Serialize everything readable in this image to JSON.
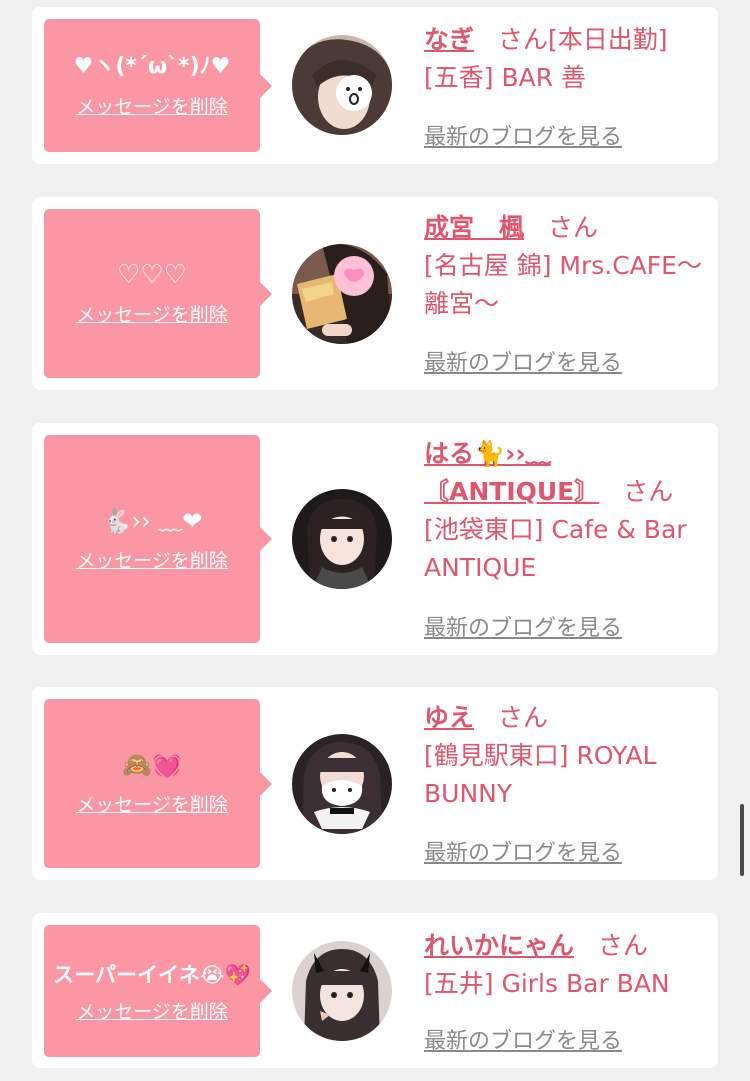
{
  "delete_label": "メッセージを削除",
  "blog_label": "最新のブログを見る",
  "honorific": "さん",
  "colors": {
    "bubble": "#fb96a5",
    "name": "#e0566c",
    "link_gray": "#8a8a8a"
  },
  "cards": [
    {
      "message": "♥︎ヽ(*ˊωˋ*)ﾉ♥︎",
      "name": "なぎ",
      "honorific_line": "さん[本日出勤]",
      "shop": "[五香] BAR 善"
    },
    {
      "message": "♡♡♡",
      "name": "成宮　楓",
      "shop": "[名古屋 錦] Mrs.CAFE〜離宮〜"
    },
    {
      "message": "🐇›› ﹏❤︎",
      "name": "はる🐈››﹏〘ANTIQUE〙",
      "shop": "[池袋東口] Cafe & Bar ANTIQUE"
    },
    {
      "message": "🙈💓",
      "name": "ゆえ",
      "shop": "[鶴見駅東口] ROYAL BUNNY"
    },
    {
      "message": "スーパーイイネ😭💖",
      "name": "れいかにゃん",
      "shop": "[五井] Girls Bar BAN"
    }
  ]
}
